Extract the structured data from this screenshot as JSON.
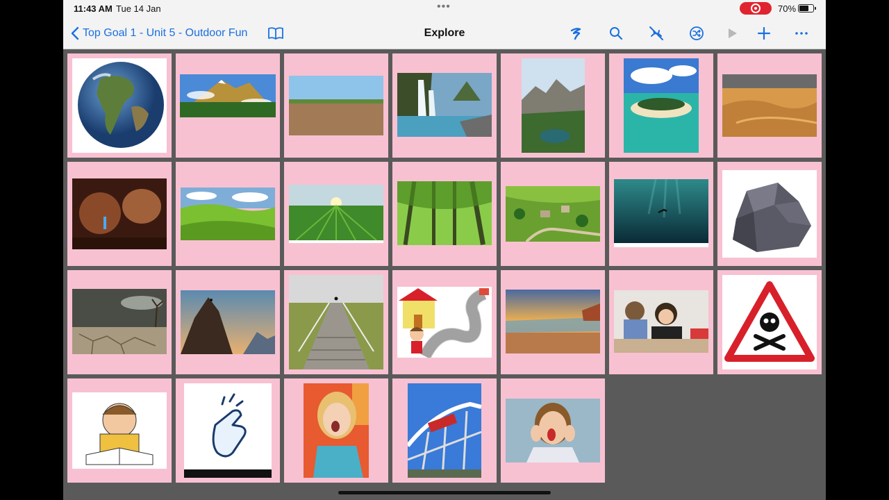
{
  "status_bar": {
    "time": "11:43 AM",
    "date": "Tue 14 Jan",
    "battery_percent": "70%",
    "battery_level": 0.7,
    "recording": true
  },
  "nav_bar": {
    "back_label": "Top Goal 1 - Unit 5 - Outdoor Fun",
    "title": "Explore",
    "icons": [
      "book-icon",
      "pencil-icon",
      "search-icon",
      "hide-icon",
      "shuffle-icon",
      "play-icon",
      "add-icon",
      "more-icon"
    ]
  },
  "colors": {
    "accent": "#1a6fe0",
    "tile": "#f8c1d2",
    "background": "#5a5a5a",
    "record": "#e0242f"
  },
  "cards": [
    {
      "id": "earth",
      "picture": "earth-globe-image"
    },
    {
      "id": "mountain",
      "picture": "mountain-image"
    },
    {
      "id": "field",
      "picture": "dry-field-image"
    },
    {
      "id": "waterfall",
      "picture": "waterfall-image"
    },
    {
      "id": "lake",
      "picture": "mountain-lake-image"
    },
    {
      "id": "island",
      "picture": "island-image"
    },
    {
      "id": "desert",
      "picture": "desert-dunes-image"
    },
    {
      "id": "cave",
      "picture": "cave-image"
    },
    {
      "id": "hills",
      "picture": "green-hills-image"
    },
    {
      "id": "farm",
      "picture": "crop-field-image"
    },
    {
      "id": "forest",
      "picture": "forest-image"
    },
    {
      "id": "village",
      "picture": "village-image"
    },
    {
      "id": "ocean",
      "picture": "deep-ocean-diver-image"
    },
    {
      "id": "rock",
      "picture": "rock-image"
    },
    {
      "id": "drought",
      "picture": "cracked-earth-image"
    },
    {
      "id": "climber",
      "picture": "rock-climber-image"
    },
    {
      "id": "stairs",
      "picture": "stairs-image"
    },
    {
      "id": "path",
      "picture": "path-home-cartoon-image"
    },
    {
      "id": "beach",
      "picture": "beach-sunset-image"
    },
    {
      "id": "bored",
      "picture": "bored-kids-image"
    },
    {
      "id": "danger",
      "picture": "danger-sign-image"
    },
    {
      "id": "worried",
      "picture": "worried-boy-cartoon-image"
    },
    {
      "id": "snap",
      "picture": "snap-fingers-image"
    },
    {
      "id": "excited-girl",
      "picture": "excited-girl-image"
    },
    {
      "id": "rollercoaster",
      "picture": "rollercoaster-image"
    },
    {
      "id": "shocked-boy",
      "picture": "shocked-boy-image"
    }
  ]
}
